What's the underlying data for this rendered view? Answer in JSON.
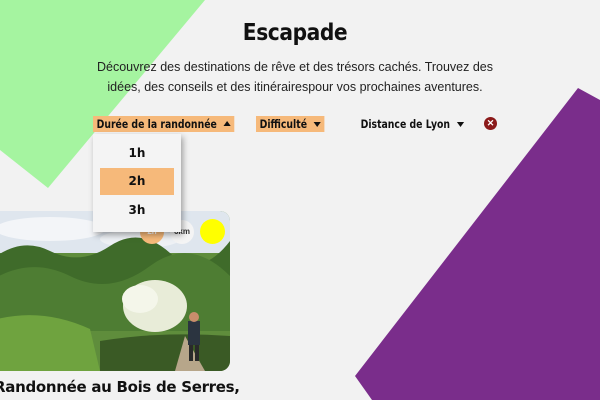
{
  "header": {
    "title": "Escapade",
    "subtitle": "Découvrez des destinations de rêve et des trésors cachés. Trouvez des idées, des conseils et des itinérairespour vos prochaines aventures."
  },
  "filters": {
    "duration_label": "Durée de la randonnée",
    "difficulty_label": "Difficulté",
    "distance_label": "Distance de Lyon",
    "reset_icon": "close-icon"
  },
  "duration_dropdown": {
    "options": [
      "1h",
      "2h",
      "3h"
    ],
    "selected": "2h"
  },
  "card": {
    "duration_badge": "2h",
    "distance_badge": "6km",
    "title": "Randonnée au Bois de Serres,"
  },
  "colors": {
    "background": "#f2f2f2",
    "green_shape": "#a5f4a0",
    "purple_shape": "#7a2d8b",
    "accent_orange": "#f6b97a",
    "difficulty_yellow": "#ffff00",
    "reset_red": "#8b1a1a"
  }
}
